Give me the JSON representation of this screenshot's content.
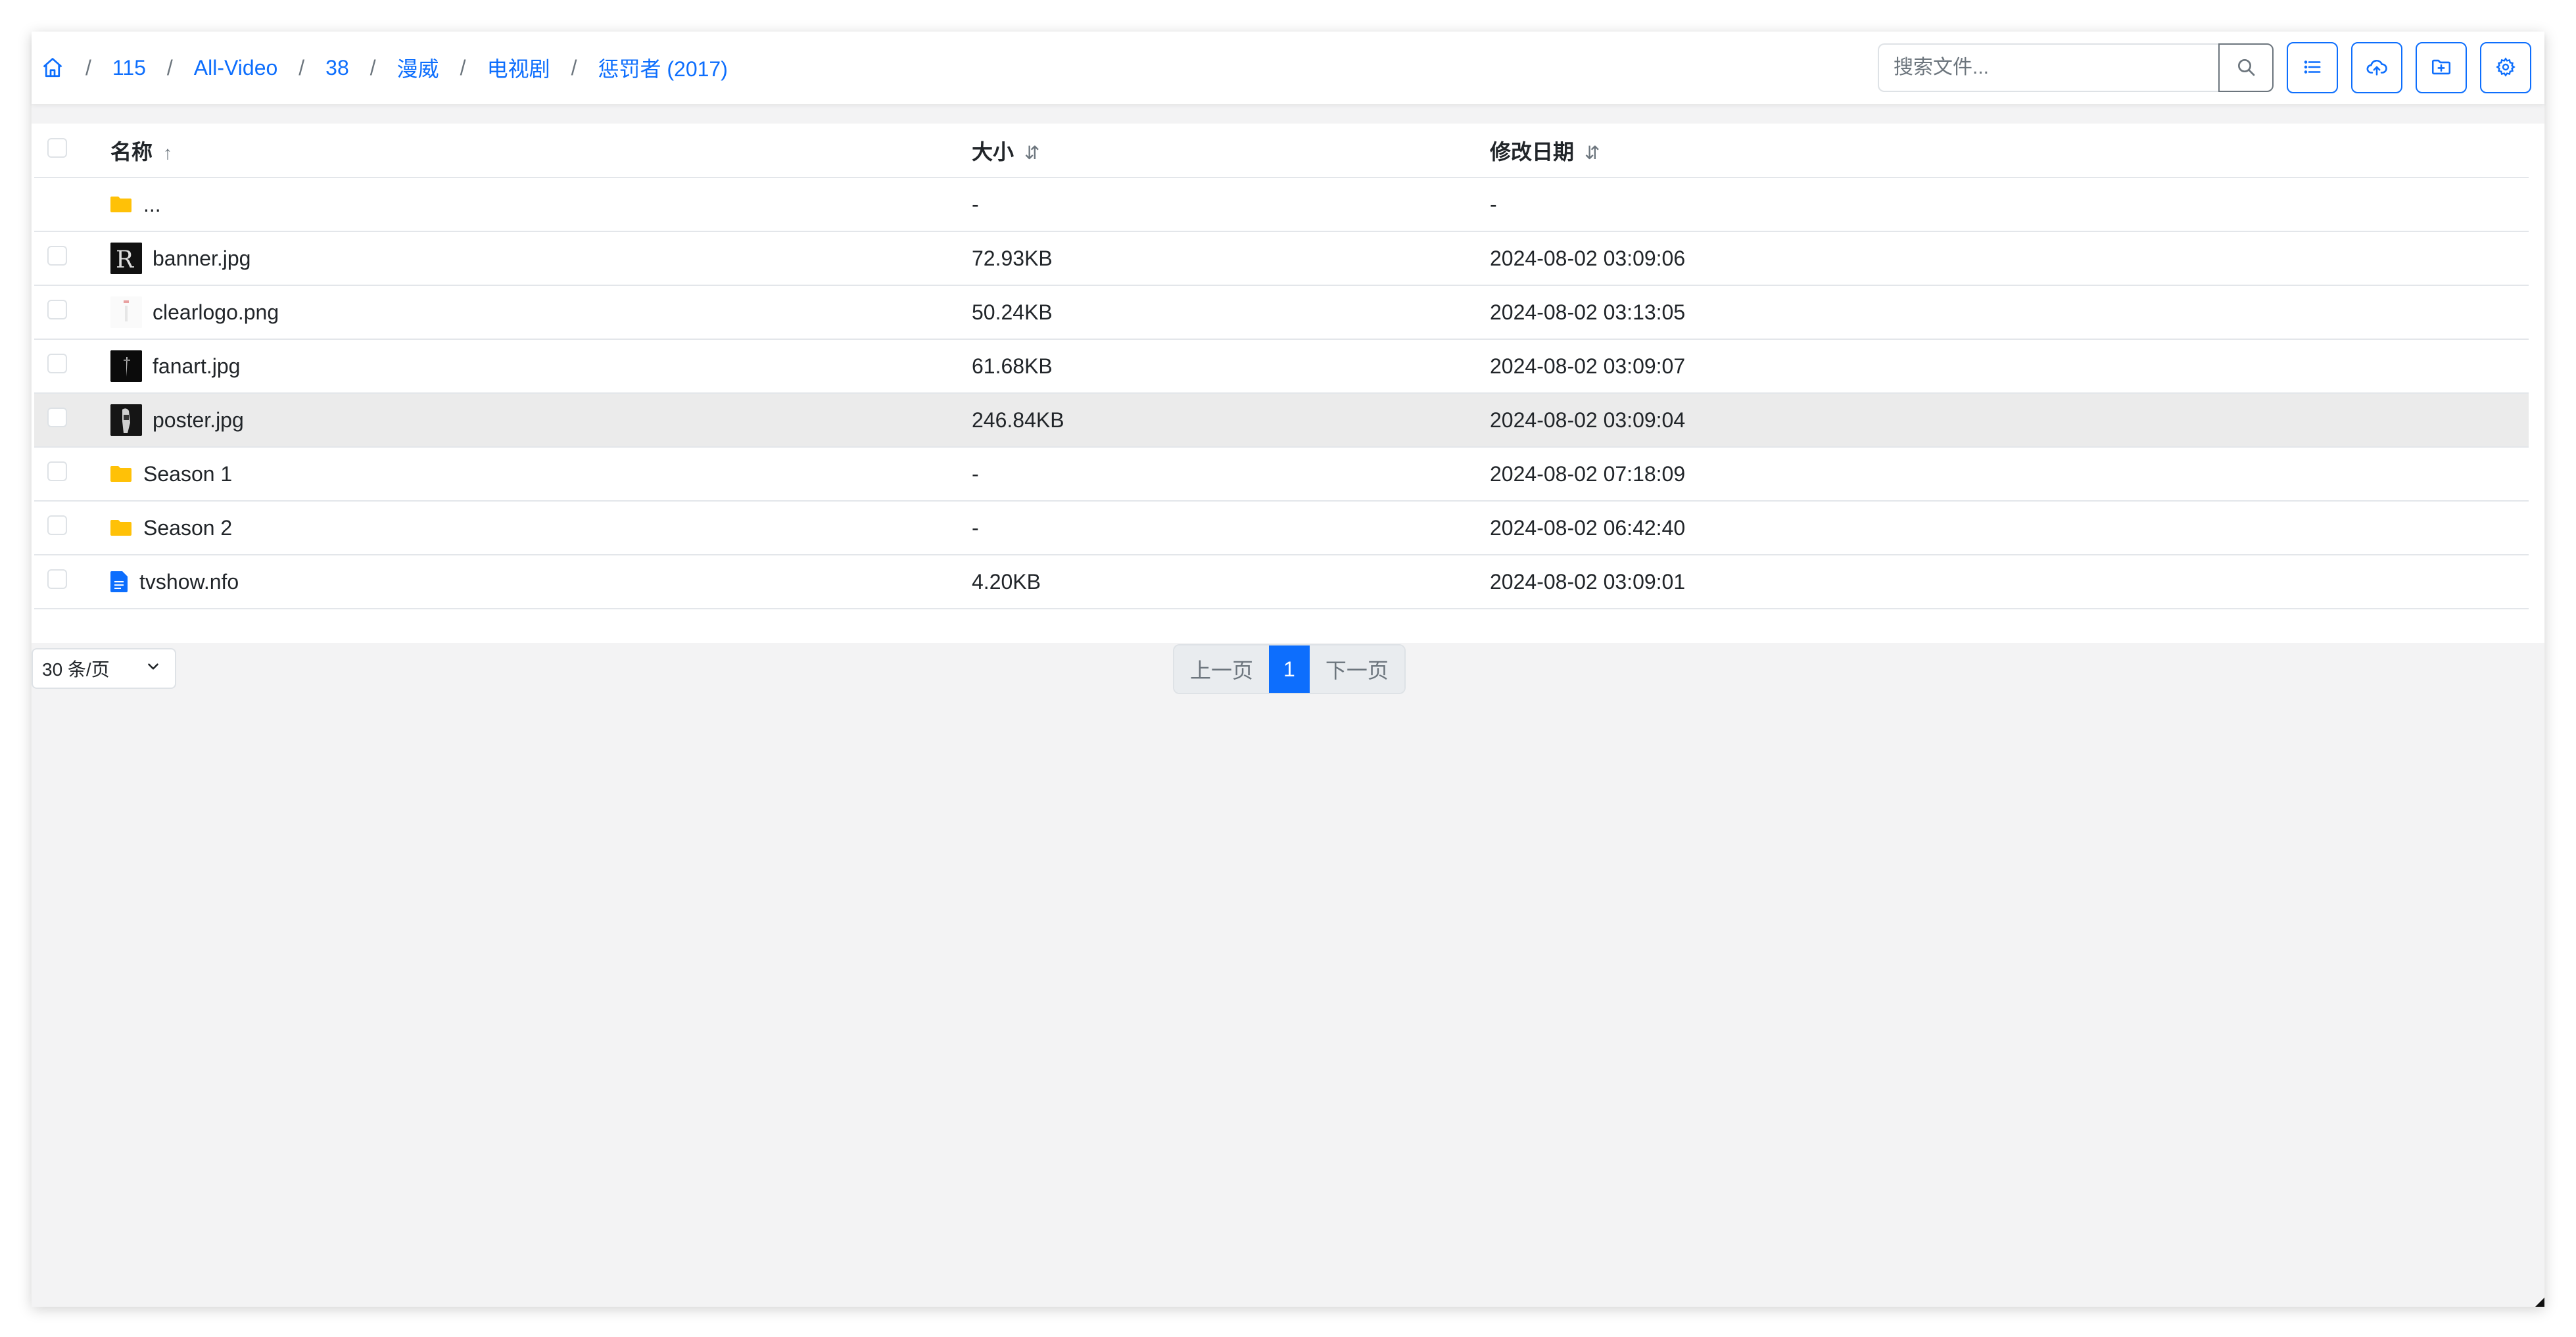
{
  "breadcrumb": {
    "home_icon": "home-icon",
    "items": [
      "115",
      "All-Video",
      "38",
      "漫威",
      "电视剧",
      "惩罚者 (2017)"
    ],
    "separator": "/"
  },
  "toolbar": {
    "search_placeholder": "搜索文件...",
    "search_value": "",
    "buttons": [
      "search-icon",
      "list-view-icon",
      "upload-cloud-icon",
      "new-folder-icon",
      "gear-icon"
    ]
  },
  "table": {
    "headers": {
      "name": "名称",
      "name_sort": "↑",
      "size": "大小",
      "size_sort": "⇵",
      "date": "修改日期",
      "date_sort": "⇵"
    },
    "rows": [
      {
        "name": "...",
        "type": "folder",
        "size": "-",
        "date": "-"
      },
      {
        "name": "banner.jpg",
        "type": "image",
        "size": "72.93KB",
        "date": "2024-08-02 03:09:06"
      },
      {
        "name": "clearlogo.png",
        "type": "image-light",
        "size": "50.24KB",
        "date": "2024-08-02 03:13:05"
      },
      {
        "name": "fanart.jpg",
        "type": "image",
        "size": "61.68KB",
        "date": "2024-08-02 03:09:07"
      },
      {
        "name": "poster.jpg",
        "type": "image",
        "size": "246.84KB",
        "date": "2024-08-02 03:09:04"
      },
      {
        "name": "Season 1",
        "type": "folder",
        "size": "-",
        "date": "2024-08-02 07:18:09"
      },
      {
        "name": "Season 2",
        "type": "folder",
        "size": "-",
        "date": "2024-08-02 06:42:40"
      },
      {
        "name": "tvshow.nfo",
        "type": "document",
        "size": "4.20KB",
        "date": "2024-08-02 03:09:01"
      }
    ]
  },
  "footer": {
    "per_page": "30 条/页",
    "prev": "上一页",
    "current_page": "1",
    "next": "下一页"
  },
  "colors": {
    "accent": "#0d6efd",
    "folder": "#ffc107",
    "background": "#f3f3f4",
    "hover_row": "#ebebeb"
  }
}
